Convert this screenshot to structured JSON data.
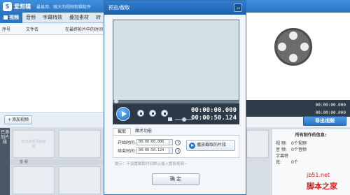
{
  "app": {
    "name": "爱剪辑",
    "slogan": "最易用、强大的视频剪辑软件",
    "tabs": [
      "视频",
      "音频",
      "字幕特效",
      "叠加素材",
      "转"
    ]
  },
  "list": {
    "col_index": "序号",
    "col_filename": "文件名",
    "col_time": "在最终影片中的时间"
  },
  "add_video_label": "添加视频",
  "timeline": {
    "side_label": "已添加片段",
    "placeholder": "双击此处添加视频",
    "audio_label": "音 频"
  },
  "right_panel": {
    "time_current": "00:00:00.000",
    "time_total": "00:00:00.000",
    "export_label": "导出视频",
    "info_title": "所有制作的信息:",
    "rows": [
      {
        "k": "视 频:",
        "v": "0个视频"
      },
      {
        "k": "音 频:",
        "v": "0个音频"
      },
      {
        "k": "字幕特效:",
        "v": "0个"
      }
    ]
  },
  "watermark": {
    "url": "jb51.net",
    "text": "脚本之家"
  },
  "dialog": {
    "title": "预览/截取",
    "time_current": "00:00:00.000",
    "time_total": "00:00:50.124",
    "tabs": [
      "截取",
      "魔术功能"
    ],
    "start_label": "开始时间:",
    "start_value": "00:00:00.000",
    "end_label": "结束时间:",
    "end_value": "00:00:50.124",
    "play_clip_label": "播放截取的片段",
    "hint": "提示：不设置截取时间默认插入整段视频~",
    "ok_label": "确 定"
  }
}
